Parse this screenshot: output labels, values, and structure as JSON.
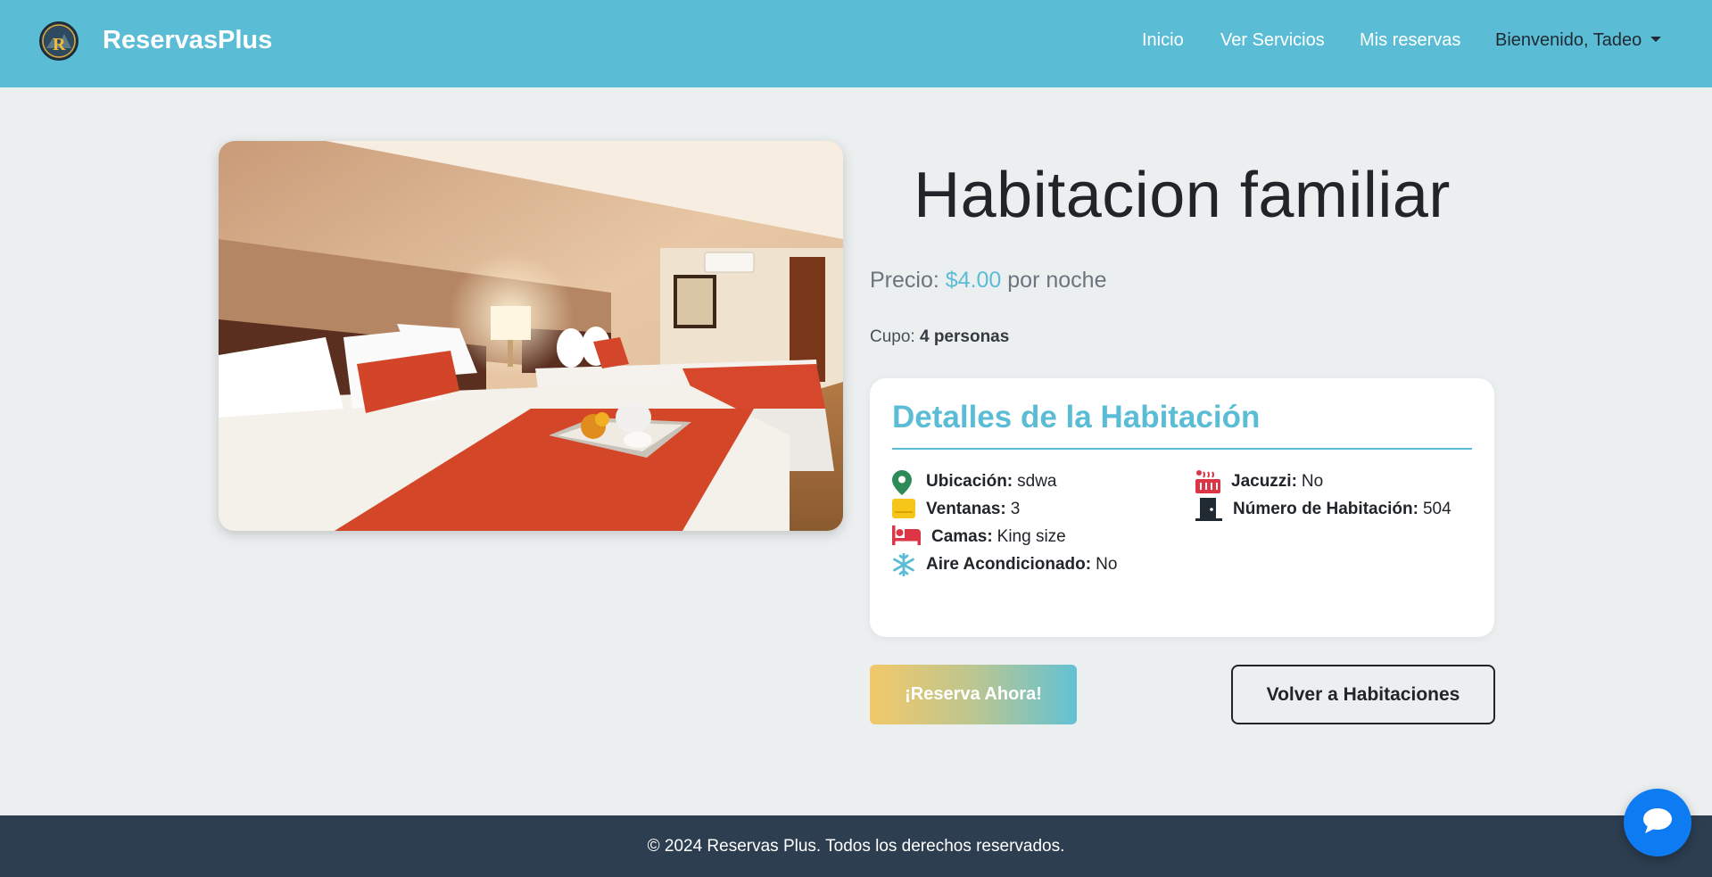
{
  "navbar": {
    "brand": "ReservasPlus",
    "logo_icon": "reservasplus-logo-icon",
    "links": {
      "home": "Inicio",
      "services": "Ver Servicios",
      "reservations": "Mis reservas",
      "user": "Bienvenido, Tadeo"
    },
    "background": "#5bbdd5"
  },
  "room": {
    "image_alt": "hotel-room-photo",
    "title": "Habitacion familiar",
    "price_label": "Precio:",
    "price_value": "$4.00",
    "price_unit": "por noche",
    "capacity_label": "Cupo:",
    "capacity_value": "4 personas"
  },
  "details": {
    "title": "Detalles de la Habitación",
    "location_label": "Ubicación:",
    "location_value": "sdwa",
    "windows_label": "Ventanas:",
    "windows_value": "3",
    "beds_label": "Camas:",
    "beds_value": "King size",
    "ac_label": "Aire Acondicionado:",
    "ac_value": "No",
    "jacuzzi_label": "Jacuzzi:",
    "jacuzzi_value": "No",
    "room_number_label": "Número de Habitación:",
    "room_number_value": "504",
    "icons": {
      "location": "map-pin-icon",
      "windows": "window-icon",
      "beds": "bed-icon",
      "ac": "snowflake-icon",
      "jacuzzi": "hot-tub-icon",
      "room_number": "door-icon"
    }
  },
  "actions": {
    "reserve": "¡Reserva Ahora!",
    "back": "Volver a Habitaciones"
  },
  "footer": {
    "text": "© 2024 Reservas Plus. Todos los derechos reservados."
  },
  "chat": {
    "icon": "chat-bubble-icon"
  },
  "colors": {
    "accent": "#5bbdd5",
    "footer": "#2c3e50",
    "chat": "#0d7bf2",
    "pin": "#2e8b57",
    "window": "#f5c518",
    "bed": "#dc3545",
    "snowflake": "#5bbdd5",
    "jacuzzi": "#dc3545",
    "door": "#1f2a33"
  }
}
